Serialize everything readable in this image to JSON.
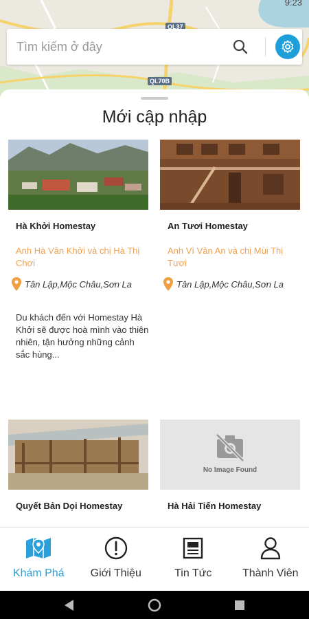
{
  "status": {
    "time": "9:23"
  },
  "map": {
    "route_labels": [
      "QL37",
      "QL70B"
    ]
  },
  "search": {
    "placeholder": "Tìm kiếm ở đây",
    "value": ""
  },
  "sheet": {
    "title": "Mới cập nhập",
    "cards": [
      {
        "name": "Hà Khởi Homestay",
        "owner": "Anh Hà Văn Khởi và chị Hà Thị Chơi",
        "address": "Tân Lập,Mộc Châu,Sơn La",
        "description": "Du khách đến với Homestay Hà Khởi sẽ được hoà mình vào thiên nhiên, tận hưởng những cảnh sắc hùng..."
      },
      {
        "name": "An Tươi Homestay",
        "owner": "Anh Vì Văn An và chị Mùi Thị Tươi",
        "address": "Tân Lập,Mộc Châu,Sơn La",
        "description": ""
      },
      {
        "name": "Quyết Bản Dọi Homestay"
      },
      {
        "name": "Hà Hải Tiến Homestay",
        "image_placeholder": "No Image Found"
      }
    ]
  },
  "nav": {
    "items": [
      {
        "label": "Khám Phá",
        "icon": "map-icon",
        "active": true
      },
      {
        "label": "Giới Thiệu",
        "icon": "info-icon",
        "active": false
      },
      {
        "label": "Tin Tức",
        "icon": "news-icon",
        "active": false
      },
      {
        "label": "Thành Viên",
        "icon": "user-icon",
        "active": false
      }
    ]
  },
  "colors": {
    "accent": "#2a9fd8",
    "owner_text": "#f0a050",
    "settings_bg": "#1e9fd9"
  }
}
